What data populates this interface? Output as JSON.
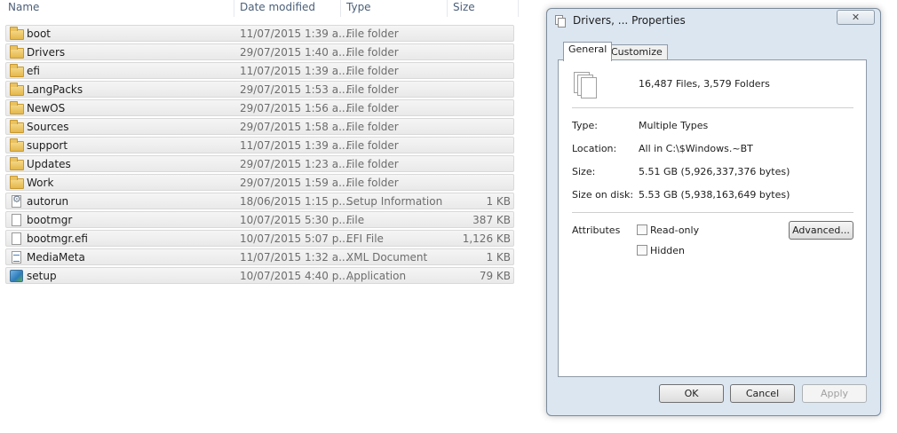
{
  "explorer": {
    "columns": {
      "name": "Name",
      "date": "Date modified",
      "type": "Type",
      "size": "Size"
    },
    "rows": [
      {
        "name": "boot",
        "date": "11/07/2015 1:39 a....",
        "type": "File folder",
        "size": "",
        "icon": "folder-icon"
      },
      {
        "name": "Drivers",
        "date": "29/07/2015 1:40 a....",
        "type": "File folder",
        "size": "",
        "icon": "folder-icon"
      },
      {
        "name": "efi",
        "date": "11/07/2015 1:39 a....",
        "type": "File folder",
        "size": "",
        "icon": "folder-icon"
      },
      {
        "name": "LangPacks",
        "date": "29/07/2015 1:53 a....",
        "type": "File folder",
        "size": "",
        "icon": "folder-icon"
      },
      {
        "name": "NewOS",
        "date": "29/07/2015 1:56 a....",
        "type": "File folder",
        "size": "",
        "icon": "folder-icon"
      },
      {
        "name": "Sources",
        "date": "29/07/2015 1:58 a....",
        "type": "File folder",
        "size": "",
        "icon": "folder-icon"
      },
      {
        "name": "support",
        "date": "11/07/2015 1:39 a....",
        "type": "File folder",
        "size": "",
        "icon": "folder-icon"
      },
      {
        "name": "Updates",
        "date": "29/07/2015 1:23 a....",
        "type": "File folder",
        "size": "",
        "icon": "folder-icon"
      },
      {
        "name": "Work",
        "date": "29/07/2015 1:59 a....",
        "type": "File folder",
        "size": "",
        "icon": "folder-icon"
      },
      {
        "name": "autorun",
        "date": "18/06/2015 1:15 p....",
        "type": "Setup Information",
        "size": "1 KB",
        "icon": "setup-info-icon"
      },
      {
        "name": "bootmgr",
        "date": "10/07/2015 5:30 p....",
        "type": "File",
        "size": "387 KB",
        "icon": "file-icon"
      },
      {
        "name": "bootmgr.efi",
        "date": "10/07/2015 5:07 p....",
        "type": "EFI File",
        "size": "1,126 KB",
        "icon": "file-icon"
      },
      {
        "name": "MediaMeta",
        "date": "11/07/2015 1:32 a....",
        "type": "XML Document",
        "size": "1 KB",
        "icon": "xml-icon"
      },
      {
        "name": "setup",
        "date": "10/07/2015 4:40 p....",
        "type": "Application",
        "size": "79 KB",
        "icon": "application-icon"
      }
    ]
  },
  "dialog": {
    "title": "Drivers, ... Properties",
    "close_label": "✕",
    "tabs": [
      {
        "label": "General",
        "active": true
      },
      {
        "label": "Customize",
        "active": false
      }
    ],
    "summary": "16,487 Files, 3,579 Folders",
    "type_label": "Type:",
    "type_value": "Multiple Types",
    "location_label": "Location:",
    "location_value": "All in C:\\$Windows.~BT",
    "size_label": "Size:",
    "size_value": "5.51 GB (5,926,337,376 bytes)",
    "size_on_disk_label": "Size on disk:",
    "size_on_disk_value": "5.53 GB (5,938,163,649 bytes)",
    "attributes_label": "Attributes",
    "readonly_label": "Read-only",
    "hidden_label": "Hidden",
    "advanced_label": "Advanced...",
    "ok_label": "OK",
    "cancel_label": "Cancel",
    "apply_label": "Apply"
  }
}
